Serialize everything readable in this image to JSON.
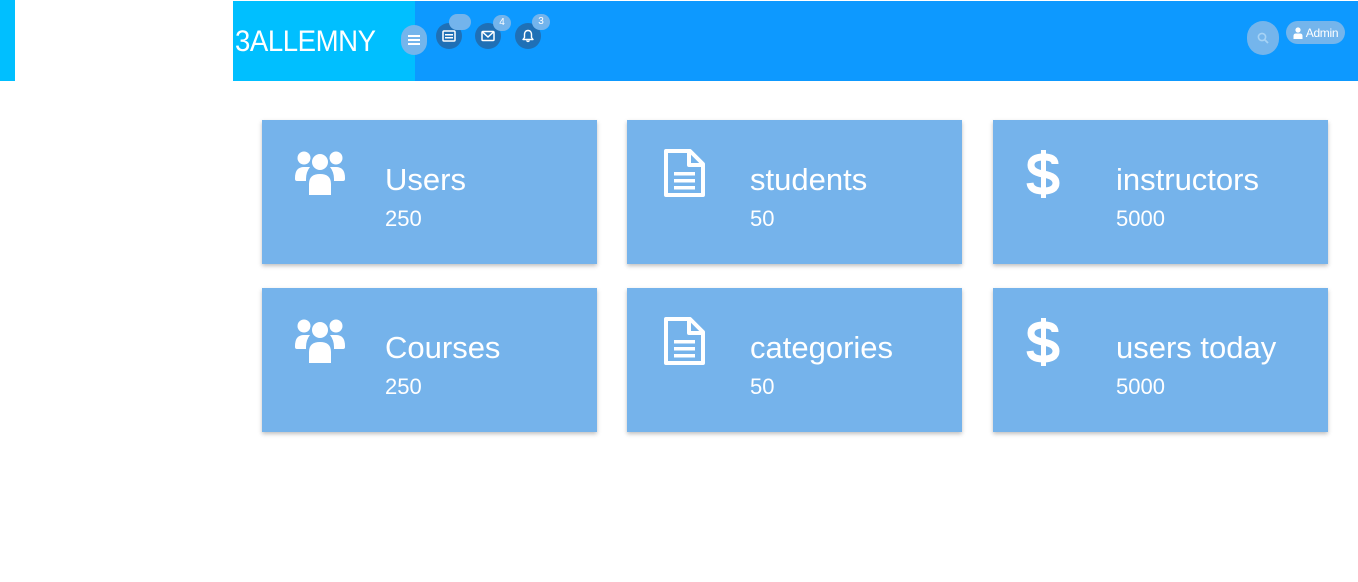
{
  "brand": {
    "name": "3ALLEMNY"
  },
  "header": {
    "notifications": [
      {
        "icon": "inbox-icon",
        "badge": ""
      },
      {
        "icon": "envelope-icon",
        "badge": "4"
      },
      {
        "icon": "bell-icon",
        "badge": "3"
      }
    ],
    "user_label": "Admin"
  },
  "stats": [
    {
      "icon": "users-icon",
      "title": "Users",
      "value": "250"
    },
    {
      "icon": "document-icon",
      "title": "students",
      "value": "50"
    },
    {
      "icon": "dollar-icon",
      "title": "instructors",
      "value": "5000"
    },
    {
      "icon": "users-icon",
      "title": "Courses",
      "value": "250"
    },
    {
      "icon": "document-icon",
      "title": "categories",
      "value": "50"
    },
    {
      "icon": "dollar-icon",
      "title": "users today",
      "value": "5000"
    }
  ],
  "colors": {
    "topbar": "#0d99ff",
    "brand_bg": "#00bfff",
    "card_bg": "#75b3eb",
    "icon_button_dark": "#1f70b6",
    "badge_bg": "#73b4ec"
  }
}
